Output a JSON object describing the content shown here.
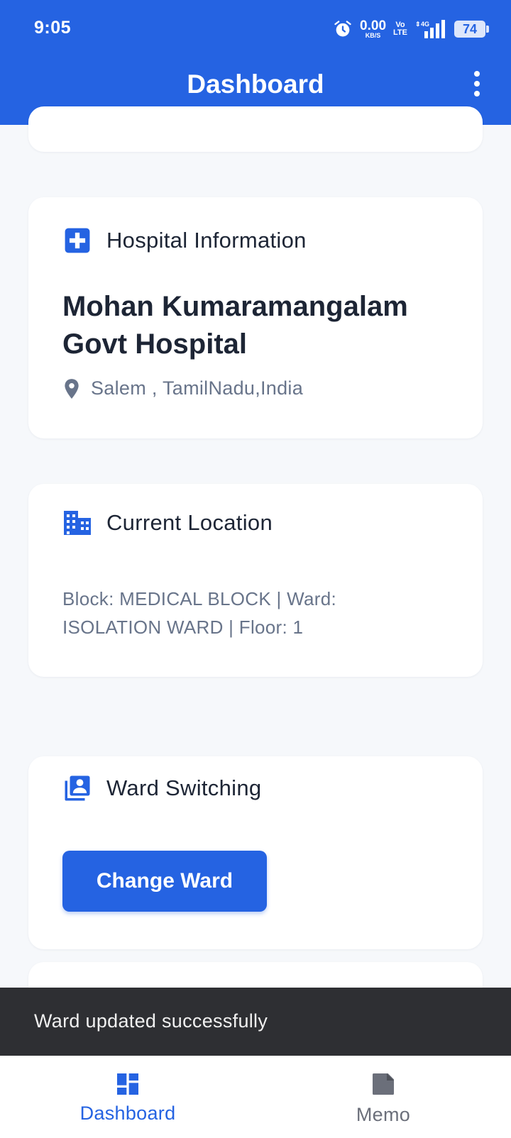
{
  "status_bar": {
    "time": "9:05",
    "net_speed_value": "0.00",
    "net_speed_unit": "KB/S",
    "volte_top": "Vo",
    "volte_bottom": "LTE",
    "network": "4G",
    "battery": "74"
  },
  "header": {
    "title": "Dashboard"
  },
  "hospital_card": {
    "title": "Hospital Information",
    "hospital_name": "Mohan Kumaramangalam Govt Hospital",
    "address": "Salem , TamilNadu,India"
  },
  "location_card": {
    "title": "Current Location",
    "details": "Block: MEDICAL BLOCK  |  Ward: ISOLATION WARD  |  Floor: 1"
  },
  "ward_card": {
    "title": "Ward Switching",
    "button_label": "Change Ward"
  },
  "snackbar": {
    "message": "Ward updated successfully"
  },
  "bottom_nav": {
    "items": [
      {
        "label": "Dashboard",
        "icon": "dashboard-icon",
        "active": true
      },
      {
        "label": "Memo",
        "icon": "memo-icon",
        "active": false
      }
    ]
  },
  "colors": {
    "primary": "#2563e2",
    "background": "#f6f8fb",
    "card": "#ffffff",
    "text_dark": "#1d2535",
    "text_muted": "#68748a",
    "snackbar": "#2e2f33"
  }
}
